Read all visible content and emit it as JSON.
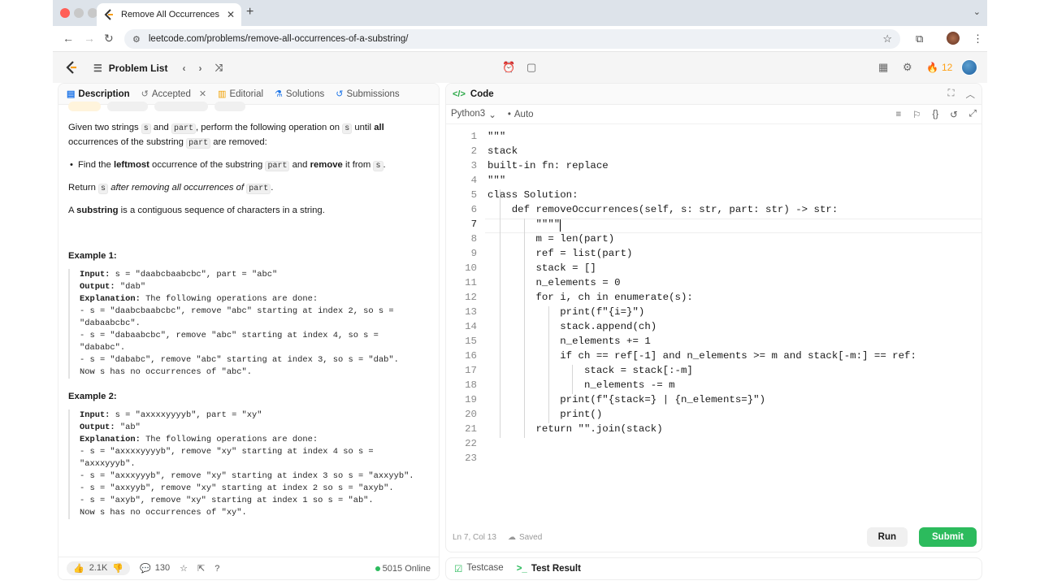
{
  "browser": {
    "tab_title": "Remove All Occurrences of a",
    "url": "leetcode.com/problems/remove-all-occurrences-of-a-substring/"
  },
  "header": {
    "problem_list": "Problem List",
    "streak": "12"
  },
  "left_tabs": [
    {
      "label": "Description"
    },
    {
      "label": "Accepted"
    },
    {
      "label": "Editorial"
    },
    {
      "label": "Solutions"
    },
    {
      "label": "Submissions"
    }
  ],
  "description": {
    "p1": [
      "Given two strings ",
      "s",
      " and ",
      "part",
      ", perform the following operation on ",
      "s",
      " until ",
      "all",
      " occurrences of the substring ",
      "part",
      " are removed:"
    ],
    "bullet": [
      "Find the ",
      "leftmost",
      " occurrence of the substring ",
      "part",
      " and ",
      "remove",
      " it from ",
      "s",
      "."
    ],
    "p2": [
      "Return ",
      "s",
      " after removing all occurrences of ",
      "part",
      "."
    ],
    "p3": [
      "A ",
      "substring",
      " is a contiguous sequence of characters in a string."
    ]
  },
  "examples": [
    {
      "title": "Example 1:",
      "lines": [
        [
          "Input:",
          " s = \"daabcbaabcbc\", part = \"abc\""
        ],
        [
          "Output:",
          " \"dab\""
        ],
        [
          "Explanation:",
          " The following operations are done:"
        ],
        [
          "",
          "- s = \"daabcbaabcbc\", remove \"abc\" starting at index 2, so s ="
        ],
        [
          "",
          "\"dabaabcbc\"."
        ],
        [
          "",
          "- s = \"dabaabcbc\", remove \"abc\" starting at index 4, so s ="
        ],
        [
          "",
          "\"dababc\"."
        ],
        [
          "",
          "- s = \"dababc\", remove \"abc\" starting at index 3, so s = \"dab\"."
        ],
        [
          "",
          "Now s has no occurrences of \"abc\"."
        ]
      ]
    },
    {
      "title": "Example 2:",
      "lines": [
        [
          "Input:",
          " s = \"axxxxyyyyb\", part = \"xy\""
        ],
        [
          "Output:",
          " \"ab\""
        ],
        [
          "Explanation:",
          " The following operations are done:"
        ],
        [
          "",
          "- s = \"axxxxyyyyb\", remove \"xy\" starting at index 4 so s ="
        ],
        [
          "",
          "\"axxxyyyb\"."
        ],
        [
          "",
          "- s = \"axxxyyyb\", remove \"xy\" starting at index 3 so s = \"axxyyb\"."
        ],
        [
          "",
          "- s = \"axxyyb\", remove \"xy\" starting at index 2 so s = \"axyb\"."
        ],
        [
          "",
          "- s = \"axyb\", remove \"xy\" starting at index 1 so s = \"ab\"."
        ],
        [
          "",
          "Now s has no occurrences of \"xy\"."
        ]
      ]
    }
  ],
  "left_footer": {
    "likes": "2.1K",
    "comments": "130",
    "online": "5015 Online"
  },
  "code_panel": {
    "title": "Code",
    "language": "Python3",
    "mode": "Auto",
    "status": "Ln 7, Col 13",
    "saved": "Saved",
    "run": "Run",
    "submit": "Submit",
    "current_line": 7,
    "lines": [
      "\"\"\"",
      "stack",
      "built-in fn: replace",
      "\"\"\"",
      "class Solution:",
      "    def removeOccurrences(self, s: str, part: str) -> str:",
      "        \"\"\"\"",
      "        m = len(part)",
      "        ref = list(part)",
      "        stack = []",
      "        n_elements = 0",
      "        for i, ch in enumerate(s):",
      "            print(f\"{i=}\")",
      "            stack.append(ch)",
      "            n_elements += 1",
      "            if ch == ref[-1] and n_elements >= m and stack[-m:] == ref:",
      "                stack = stack[:-m]",
      "                n_elements -= m",
      "            print(f\"{stack=} | {n_elements=}\")",
      "            print()",
      "        return \"\".join(stack)",
      "",
      ""
    ]
  },
  "bottom_tabs": {
    "testcase": "Testcase",
    "test_result": "Test Result"
  }
}
